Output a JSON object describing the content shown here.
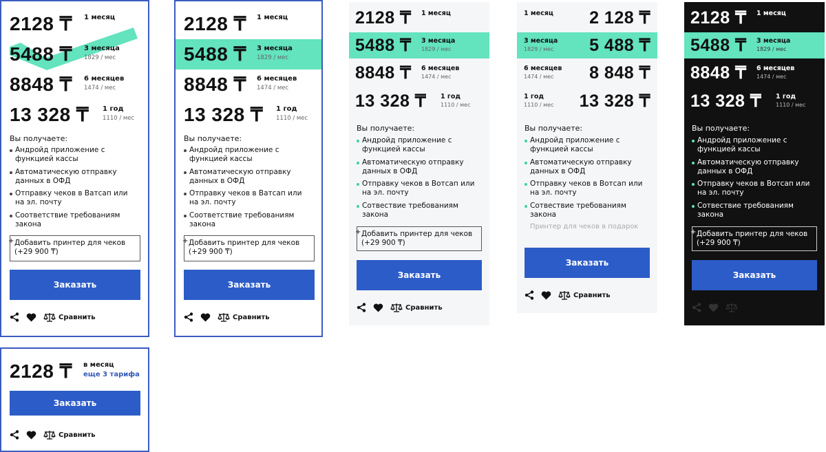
{
  "currency": "₸",
  "plans": [
    {
      "price": "2128",
      "period": "1 месяц",
      "per_month": ""
    },
    {
      "price": "5488",
      "period": "3 месяца",
      "per_month": "1829 / мес"
    },
    {
      "price": "8848",
      "period": "6 месяцев",
      "per_month": "1474 / мес"
    },
    {
      "price": "13 328",
      "period": "1 год",
      "per_month": "1110 / мес"
    }
  ],
  "plans_spaced": [
    "2 128",
    "5 488",
    "8 848",
    "13 328"
  ],
  "features_title": "Вы получаете:",
  "features_v1": [
    "Андройд приложение с функцией кассы",
    "Автоматическую отправку данных в ОФД",
    "Отправку чеков в Ватсап или на эл. почту",
    "Соответствие требованиям закона"
  ],
  "features_v2": [
    "Андройд приложение с функцией кассы",
    "Автоматическую отправку данных в ОФД",
    "Отправку чеков в Вотсап или на эл. почту",
    "Сотвествие требованиям закона"
  ],
  "printer_addon": "Добавить принтер для чеков (+29 900 ₸)",
  "printer_plus": "+",
  "printer_gift": "Принтер для чеков в подарок",
  "order_label": "Заказать",
  "compare_label": "Сравнить",
  "compact": {
    "price": "2128",
    "period": "в месяц",
    "more_link": "еще 3 тарифа"
  },
  "colors": {
    "accent": "#2c5cc8",
    "highlight": "#63e3be",
    "border": "#3a5bc0",
    "dark_bg": "#111111"
  },
  "icons": [
    "share-icon",
    "heart-icon",
    "scales-icon"
  ]
}
